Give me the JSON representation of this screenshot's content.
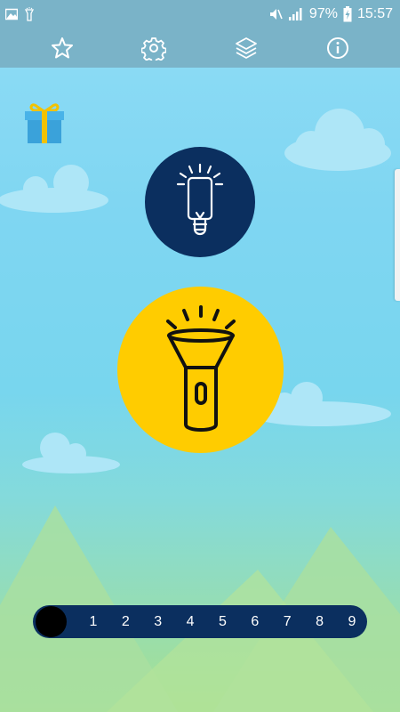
{
  "status_bar": {
    "time": "15:57",
    "battery_percent": "97%",
    "left_icons": [
      "image-icon",
      "flashlight-icon"
    ],
    "right_icons": [
      "mute-icon",
      "signal-icon",
      "battery-charging-icon"
    ]
  },
  "toolbar": {
    "buttons": [
      {
        "icon": "star-icon",
        "action": "rate"
      },
      {
        "icon": "gear-icon",
        "action": "settings"
      },
      {
        "icon": "layers-icon",
        "action": "modes"
      },
      {
        "icon": "info-icon",
        "action": "info"
      }
    ]
  },
  "main": {
    "gift_icon": "gift-icon",
    "screen_light_icon": "screen-light-icon",
    "torch_icon": "flashlight-icon"
  },
  "strobe": {
    "levels": [
      "1",
      "2",
      "3",
      "4",
      "5",
      "6",
      "7",
      "8",
      "9"
    ],
    "selected_level": 0
  },
  "colors": {
    "toolbar": "#7ab3c8",
    "navy": "#0b2f5f",
    "yellow": "#ffcc00",
    "sky": "#8fdcf5"
  }
}
